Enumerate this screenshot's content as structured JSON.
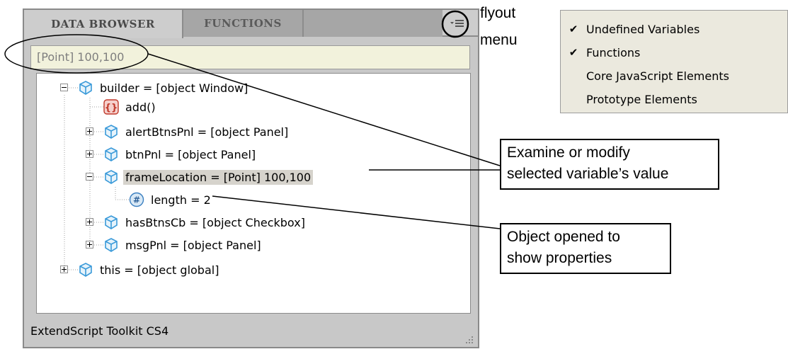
{
  "panel": {
    "tabs": [
      {
        "label": "DATA BROWSER",
        "active": true
      },
      {
        "label": "FUNCTIONS",
        "active": false
      }
    ],
    "flyout_icon": "flyout-menu-icon",
    "value_field": "[Point] 100,100",
    "status": "ExtendScript Toolkit CS4"
  },
  "tree": {
    "items": [
      {
        "text": "builder = [object Window]",
        "icon": "object-cube-icon",
        "toggle": "minus"
      },
      {
        "text": "add()",
        "icon": "function-braces-icon",
        "toggle": null
      },
      {
        "text": "alertBtnsPnl = [object Panel]",
        "icon": "object-cube-icon",
        "toggle": "plus"
      },
      {
        "text": "btnPnl = [object Panel]",
        "icon": "object-cube-icon",
        "toggle": "plus"
      },
      {
        "text": "frameLocation = [Point] 100,100",
        "icon": "object-cube-icon",
        "toggle": "minus",
        "selected": true
      },
      {
        "text": "length = 2",
        "icon": "number-hash-icon",
        "toggle": null
      },
      {
        "text": "hasBtnsCb = [object Checkbox]",
        "icon": "object-cube-icon",
        "toggle": "plus"
      },
      {
        "text": "msgPnl = [object Panel]",
        "icon": "object-cube-icon",
        "toggle": "plus"
      },
      {
        "text": "this = [object global]",
        "icon": "object-cube-icon",
        "toggle": "plus"
      }
    ]
  },
  "menu": {
    "items": [
      {
        "label": "Undefined Variables",
        "checked": true
      },
      {
        "label": "Functions",
        "checked": true
      },
      {
        "label": "Core JavaScript Elements",
        "checked": false
      },
      {
        "label": "Prototype Elements",
        "checked": false
      }
    ]
  },
  "annotations": {
    "flyout": [
      "flyout",
      "menu"
    ],
    "examine": [
      "Examine or modify",
      "selected variable’s value"
    ],
    "object": [
      "Object opened to",
      "show properties"
    ]
  },
  "colors": {
    "panel_bg": "#c8c8c8",
    "value_field_bg": "#f2f2dc",
    "selection_bg": "#d6d3cc",
    "cube_icon": "#3a9ad9",
    "function_icon": "#c0392b",
    "menu_bg": "#ebe9de"
  }
}
